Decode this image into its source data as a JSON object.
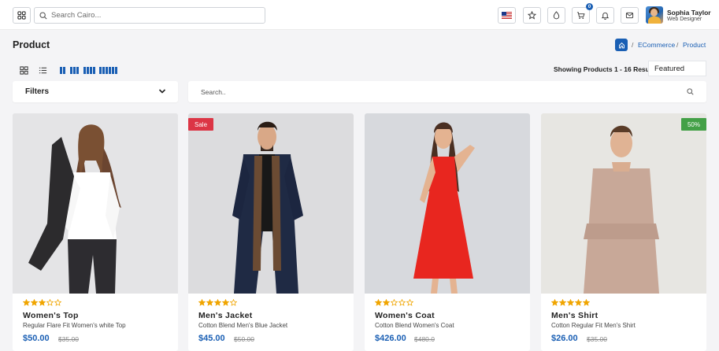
{
  "topbar": {
    "search_placeholder": "Search Cairo...",
    "cart_count": "0",
    "user_name": "Sophia Taylor",
    "user_role": "Web Designer"
  },
  "page": {
    "title": "Product",
    "breadcrumb": [
      "ECommerce",
      "Product"
    ],
    "breadcrumb_separator": "/"
  },
  "toolbar": {
    "showing_text": "Showing Products 1 - 16 Results",
    "sort_selected": "Featured"
  },
  "filters": {
    "label": "Filters"
  },
  "search": {
    "placeholder": "Search.."
  },
  "colors": {
    "accent": "#1a5fb4",
    "star": "#f0a500",
    "sale_badge": "#dc3545",
    "discount_badge": "#43a047"
  },
  "products": [
    {
      "name": "Women's Top",
      "desc": "Regular Flare Fit Women's white Top",
      "price": "$50.00",
      "old_price": "$35.00",
      "rating": 3,
      "badge": ""
    },
    {
      "name": "Men's Jacket",
      "desc": "Cotton Blend Men's Blue Jacket",
      "price": "$45.00",
      "old_price": "$50.00",
      "rating": 4,
      "badge": "Sale"
    },
    {
      "name": "Women's Coat",
      "desc": "Cotton Blend Women's Coat",
      "price": "$426.00",
      "old_price": "$480.0",
      "rating": 2,
      "badge": ""
    },
    {
      "name": "Men's Shirt",
      "desc": "Cotton Regular Fit Men's Shirt",
      "price": "$26.00",
      "old_price": "$35.00",
      "rating": 5,
      "badge": "50%"
    }
  ]
}
